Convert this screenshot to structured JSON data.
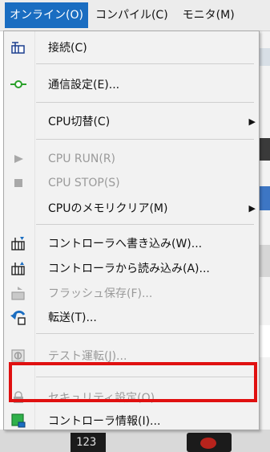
{
  "menubar": {
    "items": [
      "オンライン(O)",
      "コンパイル(C)",
      "モニタ(M)"
    ]
  },
  "menu": {
    "items": [
      {
        "label": "接続(C)",
        "icon": "connect-icon",
        "enabled": true
      },
      {
        "label": "通信設定(E)...",
        "icon": "comm-settings-icon",
        "enabled": true
      },
      {
        "label": "CPU切替(C)",
        "icon": "",
        "enabled": true,
        "submenu": true
      },
      {
        "label": "CPU RUN(R)",
        "icon": "play-icon",
        "enabled": false
      },
      {
        "label": "CPU STOP(S)",
        "icon": "stop-icon",
        "enabled": false
      },
      {
        "label": "CPUのメモリクリア(M)",
        "icon": "",
        "enabled": true,
        "submenu": true
      },
      {
        "label": "コントローラへ書き込み(W)...",
        "icon": "write-to-controller-icon",
        "enabled": true
      },
      {
        "label": "コントローラから読み込み(A)...",
        "icon": "read-from-controller-icon",
        "enabled": true
      },
      {
        "label": "フラッシュ保存(F)...",
        "icon": "flash-save-icon",
        "enabled": false
      },
      {
        "label": "転送(T)...",
        "icon": "transfer-icon",
        "enabled": true
      },
      {
        "label": "テスト運転(J)...",
        "icon": "test-run-icon",
        "enabled": false
      },
      {
        "label": "セキュリティ設定(O)...",
        "icon": "lock-icon",
        "enabled": false
      },
      {
        "label": "コントローラ情報(I)...",
        "icon": "controller-info-icon",
        "enabled": true
      }
    ],
    "submenu_arrow": "▶"
  },
  "background": {
    "counter": "123"
  },
  "colors": {
    "accent": "#1a6dc1",
    "highlight": "#e01010"
  }
}
